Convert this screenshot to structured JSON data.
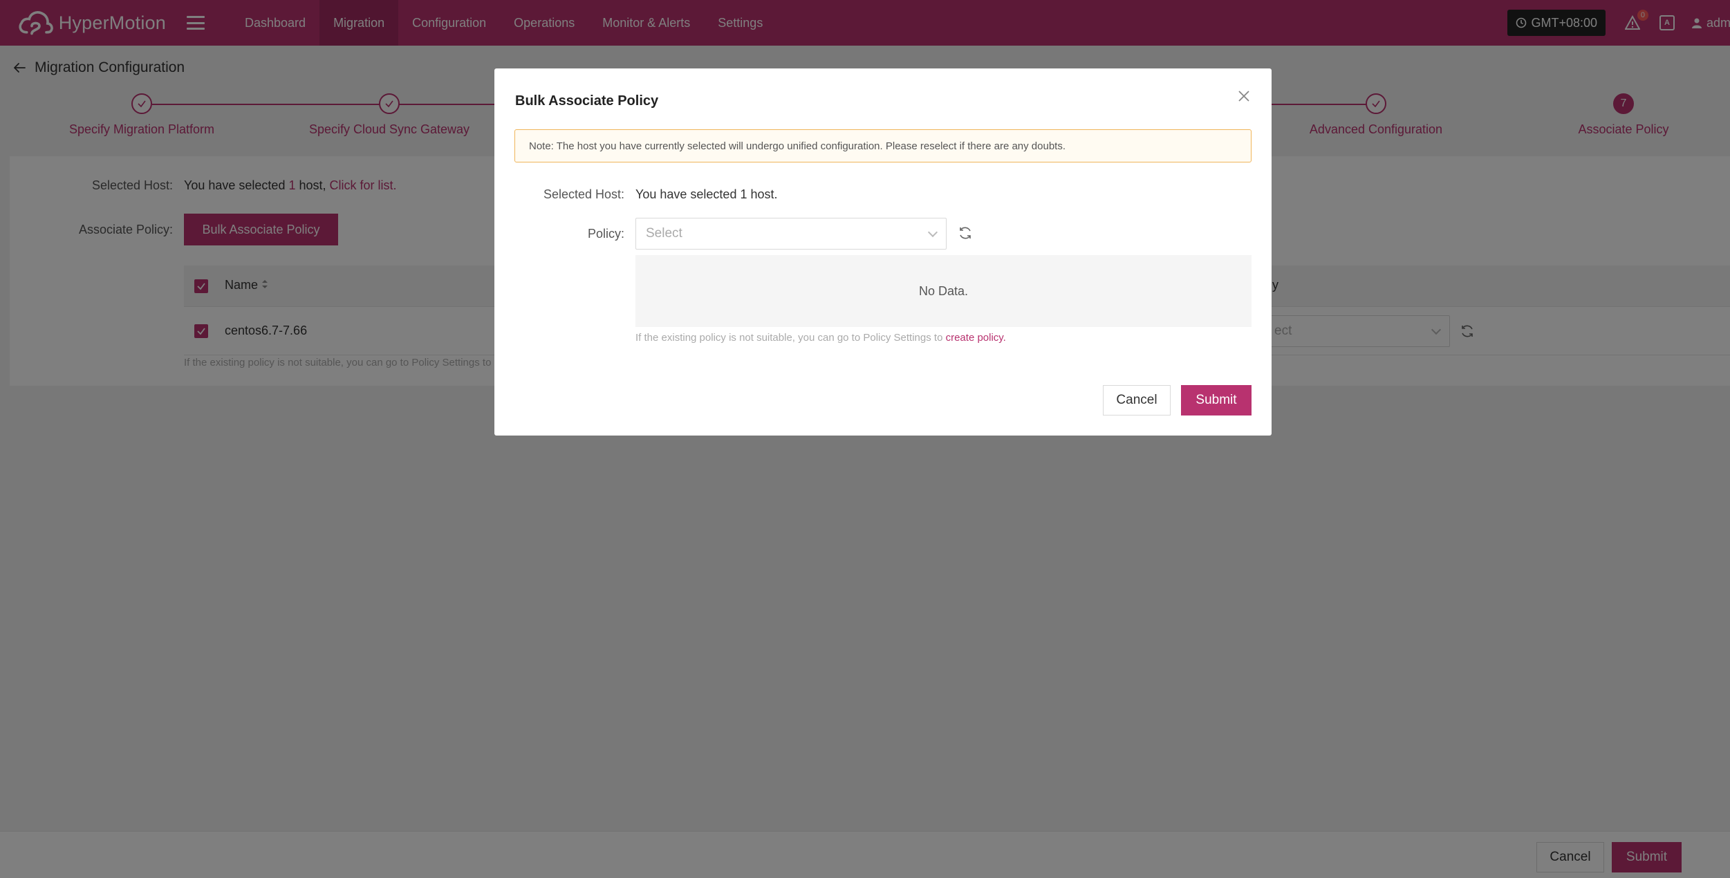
{
  "app": {
    "name": "HyperMotion"
  },
  "nav": {
    "items": [
      {
        "label": "Dashboard",
        "active": false
      },
      {
        "label": "Migration",
        "active": true
      },
      {
        "label": "Configuration",
        "active": false
      },
      {
        "label": "Operations",
        "active": false
      },
      {
        "label": "Monitor & Alerts",
        "active": false
      },
      {
        "label": "Settings",
        "active": false
      }
    ],
    "timezone": "GMT+08:00",
    "alert_count": "0",
    "lang_label": "A",
    "user": "adm"
  },
  "page": {
    "title": "Migration Configuration",
    "steps": [
      {
        "label": "Specify Migration Platform",
        "state": "done"
      },
      {
        "label": "Specify Cloud Sync Gateway",
        "state": "done"
      },
      {
        "label": "Advanced Configuration",
        "state": "done"
      },
      {
        "label": "Associate Policy",
        "state": "current",
        "number": "7"
      }
    ],
    "selected_host_label": "Selected Host:",
    "selected_host_prefix": "You have selected",
    "selected_host_count": "1",
    "selected_host_suffix": "host,",
    "click_for_list": "Click for list.",
    "associate_policy_label": "Associate Policy:",
    "bulk_button": "Bulk Associate Policy",
    "table": {
      "col_name": "Name",
      "col_policy_partial": "y",
      "rows": [
        {
          "name": "centos6.7-7.66",
          "policy_placeholder": "ect"
        }
      ]
    },
    "hint_partial": "If the existing policy is not suitable, you can go to Policy Settings to",
    "footer": {
      "cancel": "Cancel",
      "submit": "Submit"
    }
  },
  "modal": {
    "title": "Bulk Associate Policy",
    "notice": "Note: The host you have currently selected will undergo unified configuration. Please reselect if there are any doubts.",
    "selected_host_label": "Selected Host:",
    "selected_host_value": "You have selected 1 host.",
    "policy_label": "Policy:",
    "policy_placeholder": "Select",
    "no_data": "No Data.",
    "hint_prefix": "If the existing policy is not suitable, you can go to Policy Settings to",
    "hint_link": "create policy.",
    "cancel": "Cancel",
    "submit": "Submit"
  },
  "colors": {
    "brand": "#b8326f",
    "brand_dark": "#a02a60",
    "notice_border": "#f0b55a"
  }
}
